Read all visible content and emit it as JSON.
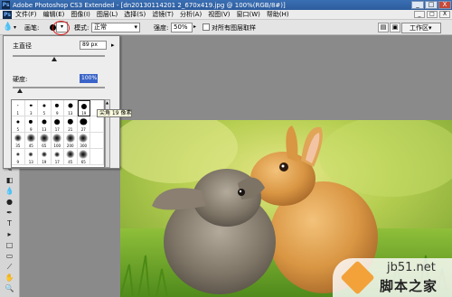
{
  "titlebar": {
    "app_icon": "Ps",
    "title": "Adobe Photoshop CS3 Extended - [dn20130114201 2_670x419.jpg @ 100%(RGB/8#)]",
    "min": "_",
    "max": "□",
    "close": "X"
  },
  "menubar": {
    "app_icon": "Ps",
    "items": [
      {
        "label": "文件(F)"
      },
      {
        "label": "编辑(E)"
      },
      {
        "label": "图像(I)"
      },
      {
        "label": "图层(L)"
      },
      {
        "label": "选择(S)"
      },
      {
        "label": "滤镜(T)"
      },
      {
        "label": "分析(A)"
      },
      {
        "label": "视图(V)"
      },
      {
        "label": "窗口(W)"
      },
      {
        "label": "帮助(H)"
      }
    ],
    "restore": "_",
    "maximize": "□",
    "close": "X"
  },
  "options": {
    "brush_label": "画笔:",
    "brush_size": "3",
    "picker_arrow": "▾",
    "mode_label": "模式:",
    "mode_value": "正常",
    "opacity_label": "强度:",
    "opacity_value": "50%",
    "opacity_arrow": "▸",
    "sample_label": "对所有图层取样",
    "workspace_label": "工作区▾"
  },
  "brush_panel": {
    "diameter_label": "主直径",
    "diameter_value": "89 px",
    "menu_arrow": "▸",
    "hardness_label": "硬度:",
    "hardness_value": "100%",
    "diameter_level": 0.45,
    "hardness_level": 1.0,
    "presets": [
      {
        "size": "1"
      },
      {
        "size": "3"
      },
      {
        "size": "5"
      },
      {
        "size": "9"
      },
      {
        "size": "13"
      },
      {
        "size": "19"
      },
      {
        "size": ""
      },
      {
        "size": "5"
      },
      {
        "size": "9"
      },
      {
        "size": "13"
      },
      {
        "size": "17"
      },
      {
        "size": "21"
      },
      {
        "size": "27"
      },
      {
        "size": ""
      },
      {
        "size": "35"
      },
      {
        "size": "45"
      },
      {
        "size": "65"
      },
      {
        "size": "100"
      },
      {
        "size": "200"
      },
      {
        "size": "300"
      },
      {
        "size": ""
      },
      {
        "size": "9"
      },
      {
        "size": "13"
      },
      {
        "size": "19"
      },
      {
        "size": "17"
      },
      {
        "size": "45"
      },
      {
        "size": "65"
      },
      {
        "size": ""
      }
    ],
    "tooltip": "尖角 19 像素"
  },
  "watermark": {
    "url": "jb51.net",
    "text": "脚本之家"
  }
}
